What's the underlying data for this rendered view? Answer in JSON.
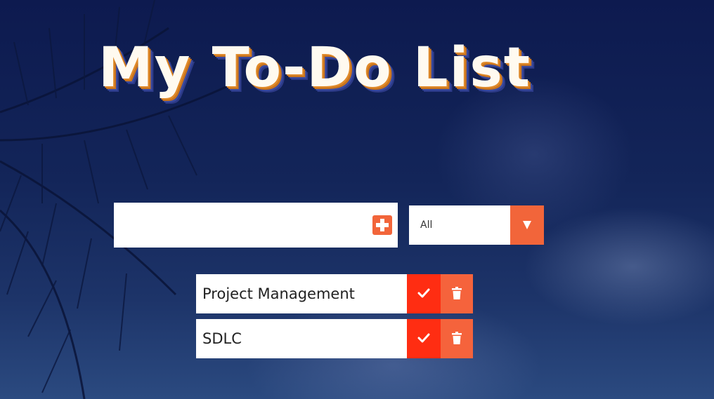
{
  "header": {
    "title": "My To-Do List"
  },
  "form": {
    "input_value": "",
    "add_icon": "plus-square-icon",
    "filter_selected": "All",
    "filter_arrow_icon": "caret-down-icon"
  },
  "todos": [
    {
      "text": "Project Management",
      "complete_icon": "check-icon",
      "delete_icon": "trash-icon"
    },
    {
      "text": "SDLC",
      "complete_icon": "check-icon",
      "delete_icon": "trash-icon"
    }
  ],
  "colors": {
    "accent": "#f2653a",
    "complete": "#ff2d12",
    "background": "#132559"
  }
}
